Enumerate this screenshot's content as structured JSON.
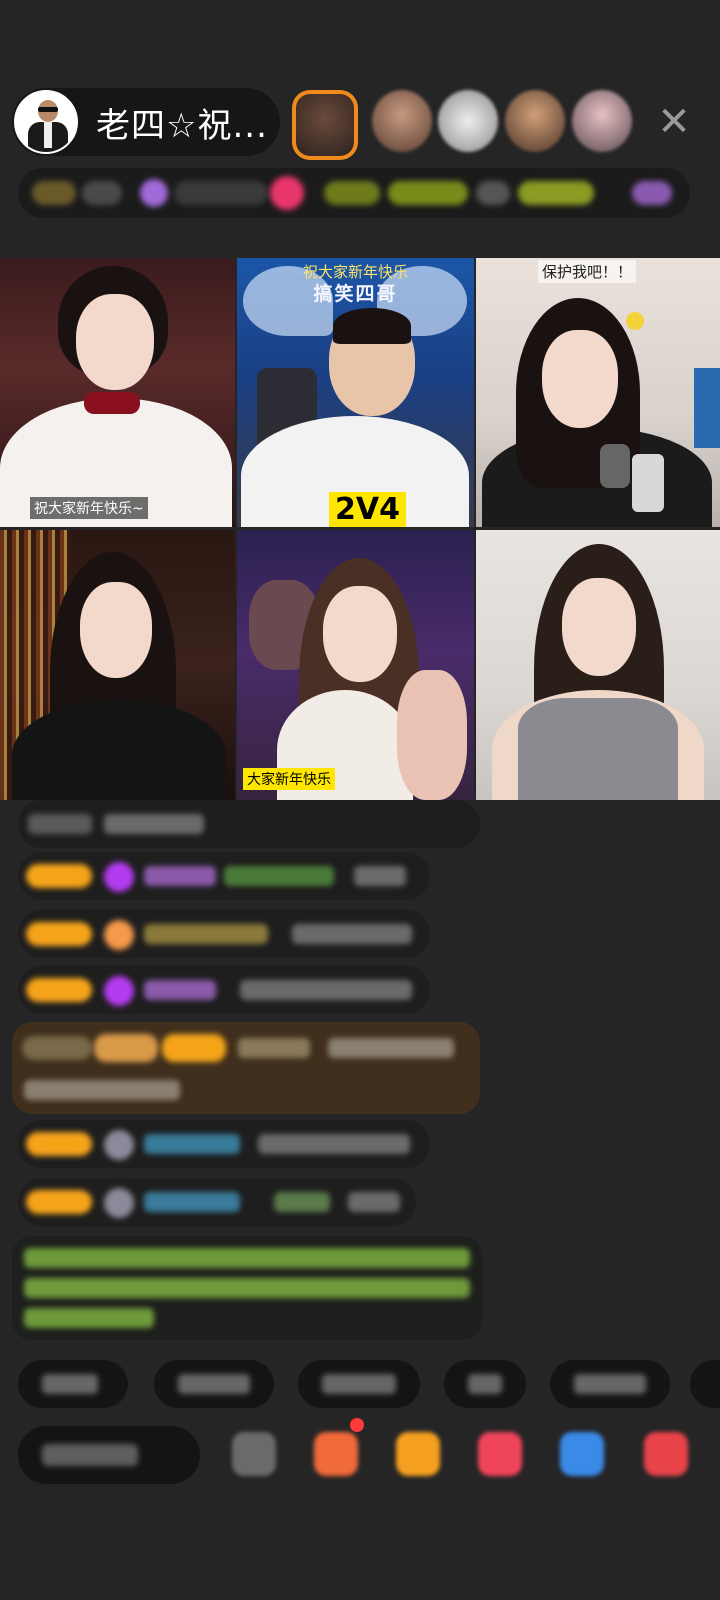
{
  "host": {
    "name": "老四☆祝...",
    "avatar_icon": "host-avatar"
  },
  "viewers": [
    "viewer-avatar-1",
    "viewer-avatar-2",
    "viewer-avatar-3",
    "viewer-avatar-4",
    "viewer-avatar-5"
  ],
  "close_label": "✕",
  "grid": {
    "tile1_caption": "祝大家新年快乐~",
    "tile2_banner": "祝大家新年快乐",
    "tile2_brand": "搞笑四哥",
    "tile2_score": "2V4",
    "tile3_caption": "保护我吧！！",
    "tile5_caption": "大家新年快乐"
  },
  "colors": {
    "background": "#252526",
    "accent_orange": "#f5a41a",
    "purple_gem": "#b43cf0",
    "score_yellow": "#ffe600",
    "system_message": "#3f2f1c",
    "notification_red": "#ff3a3a"
  },
  "icons": {
    "gift": "gift-icon",
    "share": "share-icon",
    "more": "more-icon"
  }
}
